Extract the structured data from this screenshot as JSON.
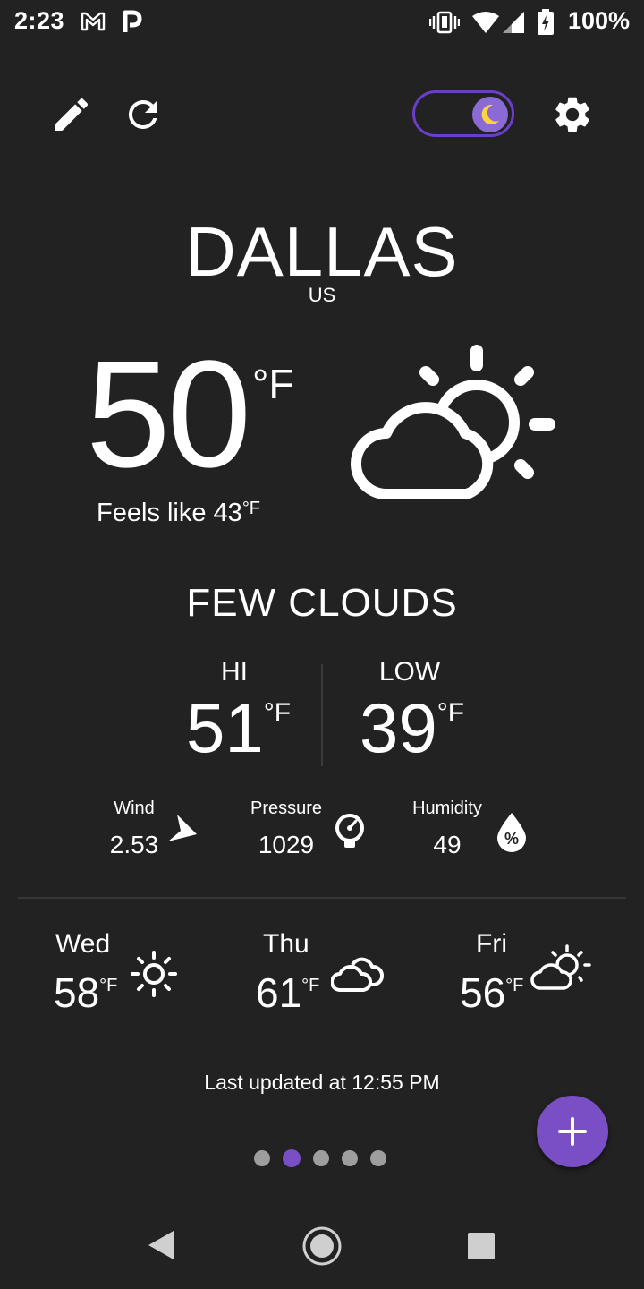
{
  "status_bar": {
    "time": "2:23",
    "battery": "100%",
    "icons": [
      "gmail-icon",
      "parking-icon",
      "vibrate-icon",
      "wifi-icon",
      "signal-icon",
      "battery-charging-icon"
    ]
  },
  "toolbar": {
    "edit_icon": "pencil-icon",
    "refresh_icon": "refresh-icon",
    "theme_toggle": "dark-mode-toggle",
    "settings_icon": "gear-icon"
  },
  "location": {
    "city": "DALLAS",
    "country": "US"
  },
  "current": {
    "temp": "50",
    "unit": "°F",
    "feels_like": "Feels like 43",
    "feels_unit": "°F",
    "condition": "FEW CLOUDS",
    "icon": "partly-cloudy-icon"
  },
  "hilo": {
    "hi_label": "HI",
    "hi_value": "51",
    "hi_unit": "°F",
    "low_label": "LOW",
    "low_value": "39",
    "low_unit": "°F"
  },
  "stats": {
    "wind_label": "Wind",
    "wind_value": "2.53",
    "pressure_label": "Pressure",
    "pressure_value": "1029",
    "humidity_label": "Humidity",
    "humidity_value": "49"
  },
  "forecast": [
    {
      "day": "Wed",
      "temp": "58",
      "unit": "°F",
      "icon": "sun-icon"
    },
    {
      "day": "Thu",
      "temp": "61",
      "unit": "°F",
      "icon": "clouds-icon"
    },
    {
      "day": "Fri",
      "temp": "56",
      "unit": "°F",
      "icon": "partly-cloudy-icon"
    }
  ],
  "last_updated": "Last updated at 12:55 PM",
  "pager": {
    "count": 5,
    "active_index": 1
  },
  "colors": {
    "background": "#222222",
    "accent": "#7a4fc6",
    "moon": "#ffd23f"
  }
}
